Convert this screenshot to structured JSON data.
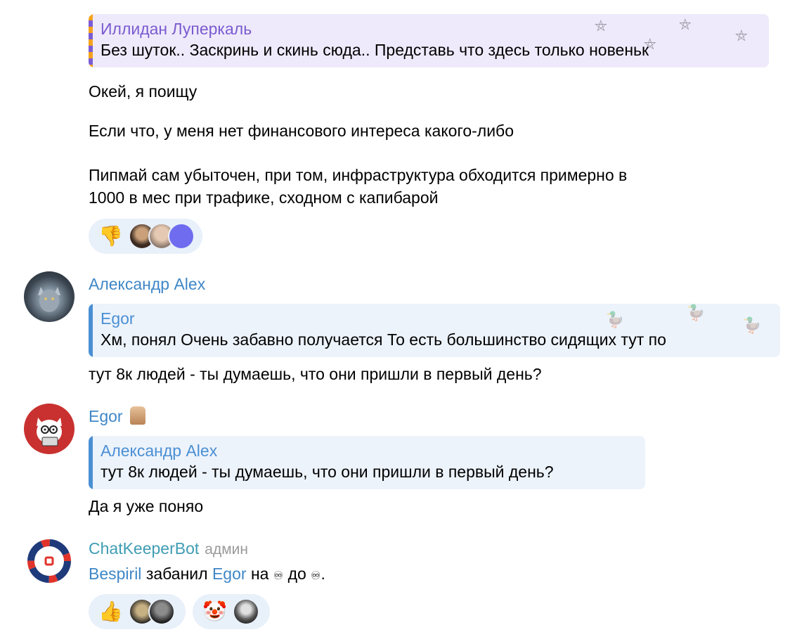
{
  "messages": {
    "m1": {
      "reply": {
        "author": "Иллидан Луперкаль",
        "text": "Без шуток.. Заскринь и скинь сюда.. Представь что здесь только новеньк"
      },
      "lines": [
        "Окей, я поищу",
        "Если что, у меня нет финансового интереса какого-либо",
        "Пипмай сам убыточен, при том, инфраструктура обходится примерно в",
        "1000 в мес при трафике, сходном с капибарой"
      ],
      "reaction": {
        "emoji": "👎"
      }
    },
    "m2": {
      "sender": "Александр Alex",
      "reply": {
        "author": "Egor",
        "text": "Хм, понял Очень забавно получается То есть большинство сидящих тут по"
      },
      "text": "тут 8к людей - ты думаешь, что они пришли в первый день?"
    },
    "m3": {
      "sender": "Egor",
      "reply": {
        "author": "Александр Alex",
        "text": "тут 8к людей - ты думаешь, что они пришли в первый день?"
      },
      "text": "Да я уже поняо"
    },
    "m4": {
      "sender": "ChatKeeperBot",
      "role": "админ",
      "ban": {
        "actor": "Bespiril",
        "verb": "забанил",
        "target": "Egor",
        "from": "на",
        "infinity1": "♾",
        "to": "до",
        "infinity2": "♾",
        "end": "."
      },
      "reactions": [
        {
          "emoji": "👍"
        },
        {
          "emoji": "🤡"
        }
      ]
    }
  },
  "colors": {
    "link": "#3f87c7",
    "quote_bg": "#edf3fb",
    "reaction_bg": "#e8f0fa",
    "accent_purple": "#7a5bd0"
  }
}
